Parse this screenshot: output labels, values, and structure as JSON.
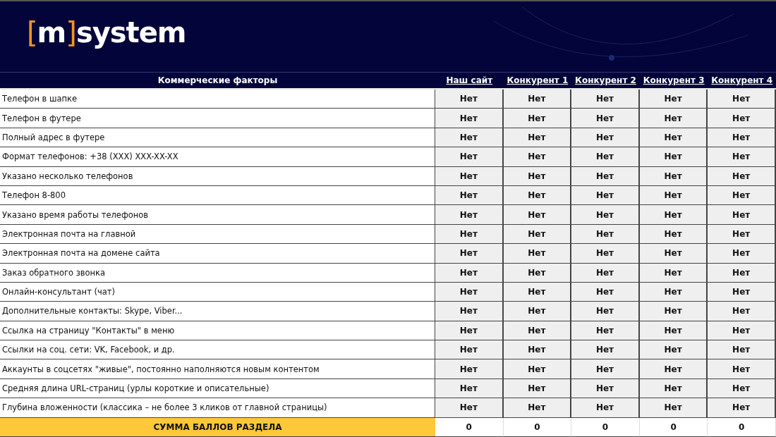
{
  "header": {
    "logo": [
      {
        "text": "[",
        "accent": true
      },
      {
        "text": "m",
        "accent": false
      },
      {
        "text": "]",
        "accent": true
      },
      {
        "text": "system",
        "accent": false
      }
    ]
  },
  "table": {
    "columns": [
      "Коммерческие факторы",
      "Наш сайт",
      "Конкурент 1",
      "Конкурент 2",
      "Конкурент 3",
      "Конкурент 4"
    ],
    "rows": [
      {
        "factor": "Телефон в шапке",
        "values": [
          "Нет",
          "Нет",
          "Нет",
          "Нет",
          "Нет"
        ]
      },
      {
        "factor": "Телефон в футере",
        "values": [
          "Нет",
          "Нет",
          "Нет",
          "Нет",
          "Нет"
        ]
      },
      {
        "factor": "Полный адрес в футере",
        "values": [
          "Нет",
          "Нет",
          "Нет",
          "Нет",
          "Нет"
        ]
      },
      {
        "factor": "Формат телефонов: +38 (XXX) XXX-XX-XX",
        "values": [
          "Нет",
          "Нет",
          "Нет",
          "Нет",
          "Нет"
        ]
      },
      {
        "factor": "Указано несколько телефонов",
        "values": [
          "Нет",
          "Нет",
          "Нет",
          "Нет",
          "Нет"
        ]
      },
      {
        "factor": "Телефон 8-800",
        "values": [
          "Нет",
          "Нет",
          "Нет",
          "Нет",
          "Нет"
        ]
      },
      {
        "factor": "Указано время работы телефонов",
        "values": [
          "Нет",
          "Нет",
          "Нет",
          "Нет",
          "Нет"
        ]
      },
      {
        "factor": "Электронная почта на главной",
        "values": [
          "Нет",
          "Нет",
          "Нет",
          "Нет",
          "Нет"
        ]
      },
      {
        "factor": "Электронная почта на домене сайта",
        "values": [
          "Нет",
          "Нет",
          "Нет",
          "Нет",
          "Нет"
        ]
      },
      {
        "factor": "Заказ обратного звонка",
        "values": [
          "Нет",
          "Нет",
          "Нет",
          "Нет",
          "Нет"
        ]
      },
      {
        "factor": "Онлайн-консультант (чат)",
        "values": [
          "Нет",
          "Нет",
          "Нет",
          "Нет",
          "Нет"
        ]
      },
      {
        "factor": "Дополнительные контакты: Skype, Viber...",
        "values": [
          "Нет",
          "Нет",
          "Нет",
          "Нет",
          "Нет"
        ]
      },
      {
        "factor": "Ссылка на страницу \"Контакты\" в меню",
        "values": [
          "Нет",
          "Нет",
          "Нет",
          "Нет",
          "Нет"
        ]
      },
      {
        "factor": "Ссылки на соц. сети: VK, Facebook, и др.",
        "values": [
          "Нет",
          "Нет",
          "Нет",
          "Нет",
          "Нет"
        ]
      },
      {
        "factor": "Аккаунты в соцсетях \"живые\", постоянно наполняются новым контентом",
        "values": [
          "Нет",
          "Нет",
          "Нет",
          "Нет",
          "Нет"
        ]
      },
      {
        "factor": "Средняя длина URL-страниц (урлы короткие и описательные)",
        "values": [
          "Нет",
          "Нет",
          "Нет",
          "Нет",
          "Нет"
        ]
      },
      {
        "factor": "Глубина вложенности (классика – не более 3 кликов от главной страницы)",
        "values": [
          "Нет",
          "Нет",
          "Нет",
          "Нет",
          "Нет"
        ]
      }
    ],
    "total": {
      "label": "СУММА БАЛЛОВ РАЗДЕЛА",
      "values": [
        "0",
        "0",
        "0",
        "0",
        "0"
      ]
    }
  }
}
